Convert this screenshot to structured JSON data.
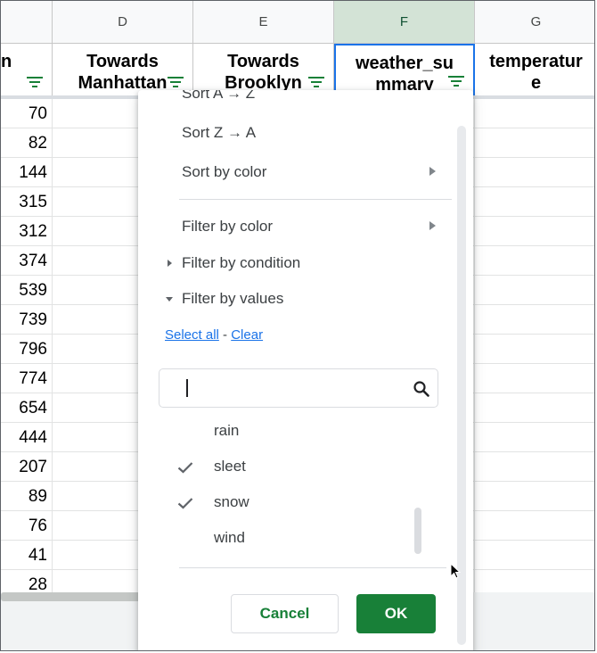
{
  "columns": {
    "letters": [
      "",
      "D",
      "E",
      "F",
      "G"
    ],
    "headers": [
      {
        "line1": "n",
        "line2": ""
      },
      {
        "line1": "Towards",
        "line2": "Manhattan"
      },
      {
        "line1": "Towards",
        "line2": "Brooklyn"
      },
      {
        "line1": "weather_su",
        "line2": "mmary"
      },
      {
        "line1": "temperatur",
        "line2": "e"
      }
    ]
  },
  "rows": [
    "70",
    "82",
    "144",
    "315",
    "312",
    "374",
    "539",
    "739",
    "796",
    "774",
    "654",
    "444",
    "207",
    "89",
    "76",
    "41",
    "28"
  ],
  "menu": {
    "sort_az": "Sort A → Z",
    "sort_za": "Sort Z → A",
    "sort_by_color": "Sort by color",
    "filter_by_color": "Filter by color",
    "filter_by_condition": "Filter by condition",
    "filter_by_values": "Filter by values",
    "select_all": "Select all",
    "separator": " - ",
    "clear": "Clear",
    "search_value": "",
    "values": [
      {
        "label": "rain",
        "checked": false
      },
      {
        "label": "sleet",
        "checked": true
      },
      {
        "label": "snow",
        "checked": true
      },
      {
        "label": "wind",
        "checked": false
      }
    ],
    "cancel_label": "Cancel",
    "ok_label": "OK"
  },
  "colors": {
    "accent_green": "#188038",
    "link_blue": "#1a73e8",
    "selection_blue": "#1a73e8"
  }
}
